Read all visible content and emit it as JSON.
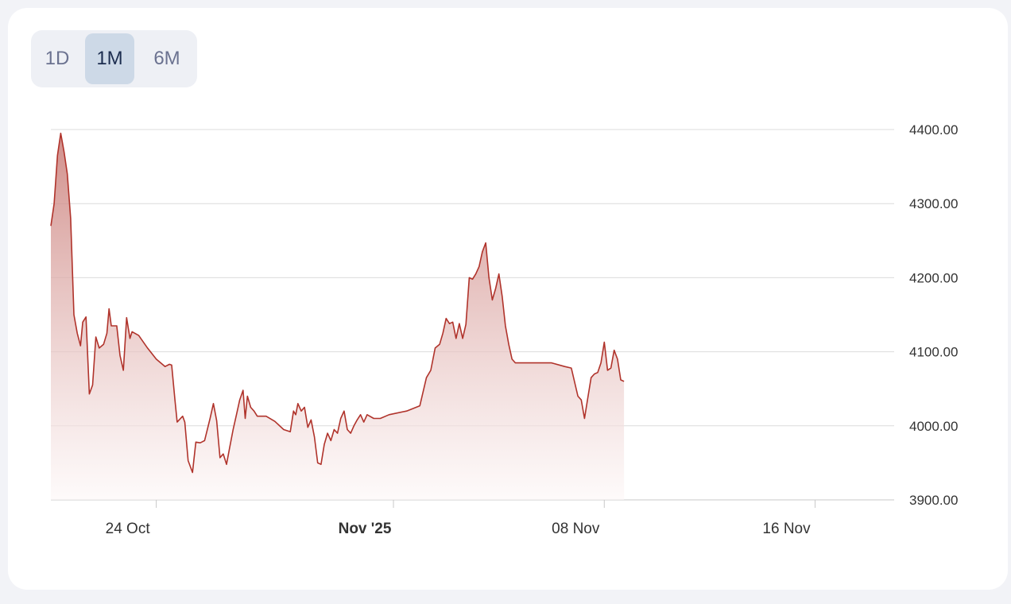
{
  "range_selector": {
    "options": [
      "1D",
      "1M",
      "6M"
    ],
    "active": "1M"
  },
  "colors": {
    "line": "#b0332b",
    "fill_top": "#c97b76",
    "fill_bottom": "#fdf7f7",
    "grid": "#dcdcdc",
    "axis_text": "#333333"
  },
  "chart_data": {
    "type": "area",
    "title": "",
    "xlabel": "",
    "ylabel": "",
    "x_start": "2025-10-19",
    "x_end": "2025-11-20",
    "ylim": [
      3900,
      4400
    ],
    "y_ticks": [
      "4400.00",
      "4300.00",
      "4200.00",
      "4100.00",
      "4000.00",
      "3900.00"
    ],
    "y_tick_values": [
      4400,
      4300,
      4200,
      4100,
      4000,
      3900
    ],
    "x_ticks": [
      {
        "label": "24 Oct",
        "date": "2025-10-23",
        "bold": false
      },
      {
        "label": "Nov '25",
        "date": "2025-11-01",
        "bold": true
      },
      {
        "label": "08 Nov",
        "date": "2025-11-09",
        "bold": false
      },
      {
        "label": "16 Nov",
        "date": "2025-11-17",
        "bold": false
      }
    ],
    "grid": true,
    "series": [
      {
        "points": [
          [
            "2025-10-19T00:00",
            4270
          ],
          [
            "2025-10-19T03:00",
            4300
          ],
          [
            "2025-10-19T06:00",
            4365
          ],
          [
            "2025-10-19T09:00",
            4395
          ],
          [
            "2025-10-19T12:00",
            4370
          ],
          [
            "2025-10-19T15:00",
            4340
          ],
          [
            "2025-10-19T18:00",
            4280
          ],
          [
            "2025-10-19T21:00",
            4150
          ],
          [
            "2025-10-20T00:00",
            4125
          ],
          [
            "2025-10-20T03:00",
            4108
          ],
          [
            "2025-10-20T05:00",
            4140
          ],
          [
            "2025-10-20T08:00",
            4147
          ],
          [
            "2025-10-20T11:00",
            4043
          ],
          [
            "2025-10-20T14:00",
            4055
          ],
          [
            "2025-10-20T17:00",
            4120
          ],
          [
            "2025-10-20T20:00",
            4105
          ],
          [
            "2025-10-21T00:00",
            4110
          ],
          [
            "2025-10-21T03:00",
            4125
          ],
          [
            "2025-10-21T05:00",
            4158
          ],
          [
            "2025-10-21T07:00",
            4135
          ],
          [
            "2025-10-21T12:00",
            4135
          ],
          [
            "2025-10-21T15:00",
            4095
          ],
          [
            "2025-10-21T18:00",
            4075
          ],
          [
            "2025-10-21T21:00",
            4146
          ],
          [
            "2025-10-22T00:00",
            4118
          ],
          [
            "2025-10-22T02:00",
            4127
          ],
          [
            "2025-10-22T08:00",
            4122
          ],
          [
            "2025-10-22T16:00",
            4105
          ],
          [
            "2025-10-23T00:00",
            4090
          ],
          [
            "2025-10-23T08:00",
            4080
          ],
          [
            "2025-10-23T12:00",
            4083
          ],
          [
            "2025-10-23T14:00",
            4082
          ],
          [
            "2025-10-23T17:00",
            4035
          ],
          [
            "2025-10-23T19:00",
            4005
          ],
          [
            "2025-10-24T00:00",
            4013
          ],
          [
            "2025-10-24T02:00",
            4005
          ],
          [
            "2025-10-24T05:00",
            3953
          ],
          [
            "2025-10-24T09:00",
            3937
          ],
          [
            "2025-10-24T12:00",
            3978
          ],
          [
            "2025-10-24T16:00",
            3977
          ],
          [
            "2025-10-24T20:00",
            3980
          ],
          [
            "2025-10-25T01:00",
            4010
          ],
          [
            "2025-10-25T04:00",
            4030
          ],
          [
            "2025-10-25T07:00",
            4007
          ],
          [
            "2025-10-25T10:00",
            3957
          ],
          [
            "2025-10-25T13:00",
            3962
          ],
          [
            "2025-10-25T16:00",
            3948
          ],
          [
            "2025-10-25T19:00",
            3972
          ],
          [
            "2025-10-25T22:00",
            3995
          ],
          [
            "2025-10-26T01:00",
            4015
          ],
          [
            "2025-10-26T04:00",
            4035
          ],
          [
            "2025-10-26T07:00",
            4048
          ],
          [
            "2025-10-26T09:00",
            4010
          ],
          [
            "2025-10-26T11:00",
            4040
          ],
          [
            "2025-10-26T14:00",
            4025
          ],
          [
            "2025-10-26T17:00",
            4020
          ],
          [
            "2025-10-26T20:00",
            4013
          ],
          [
            "2025-10-27T04:00",
            4013
          ],
          [
            "2025-10-27T12:00",
            4006
          ],
          [
            "2025-10-27T20:00",
            3995
          ],
          [
            "2025-10-28T02:00",
            3992
          ],
          [
            "2025-10-28T05:00",
            4020
          ],
          [
            "2025-10-28T07:00",
            4015
          ],
          [
            "2025-10-28T09:00",
            4030
          ],
          [
            "2025-10-28T12:00",
            4020
          ],
          [
            "2025-10-28T15:00",
            4025
          ],
          [
            "2025-10-28T18:00",
            3998
          ],
          [
            "2025-10-28T21:00",
            4008
          ],
          [
            "2025-10-29T00:00",
            3985
          ],
          [
            "2025-10-29T03:00",
            3950
          ],
          [
            "2025-10-29T06:00",
            3948
          ],
          [
            "2025-10-29T09:00",
            3975
          ],
          [
            "2025-10-29T12:00",
            3990
          ],
          [
            "2025-10-29T15:00",
            3980
          ],
          [
            "2025-10-29T18:00",
            3995
          ],
          [
            "2025-10-29T21:00",
            3990
          ],
          [
            "2025-10-30T00:00",
            4010
          ],
          [
            "2025-10-30T03:00",
            4020
          ],
          [
            "2025-10-30T06:00",
            3995
          ],
          [
            "2025-10-30T09:00",
            3990
          ],
          [
            "2025-10-30T12:00",
            4000
          ],
          [
            "2025-10-30T15:00",
            4008
          ],
          [
            "2025-10-30T18:00",
            4015
          ],
          [
            "2025-10-30T21:00",
            4005
          ],
          [
            "2025-10-31T00:00",
            4015
          ],
          [
            "2025-10-31T06:00",
            4010
          ],
          [
            "2025-10-31T12:00",
            4010
          ],
          [
            "2025-10-31T20:00",
            4015
          ],
          [
            "2025-11-01T12:00",
            4020
          ],
          [
            "2025-11-02T00:00",
            4027
          ],
          [
            "2025-11-02T06:00",
            4065
          ],
          [
            "2025-11-02T10:00",
            4075
          ],
          [
            "2025-11-02T14:00",
            4105
          ],
          [
            "2025-11-02T18:00",
            4110
          ],
          [
            "2025-11-02T21:00",
            4125
          ],
          [
            "2025-11-03T00:00",
            4145
          ],
          [
            "2025-11-03T03:00",
            4138
          ],
          [
            "2025-11-03T06:00",
            4140
          ],
          [
            "2025-11-03T09:00",
            4118
          ],
          [
            "2025-11-03T12:00",
            4138
          ],
          [
            "2025-11-03T15:00",
            4118
          ],
          [
            "2025-11-03T18:00",
            4137
          ],
          [
            "2025-11-03T21:00",
            4200
          ],
          [
            "2025-11-04T00:00",
            4198
          ],
          [
            "2025-11-04T03:00",
            4205
          ],
          [
            "2025-11-04T06:00",
            4215
          ],
          [
            "2025-11-04T09:00",
            4235
          ],
          [
            "2025-11-04T12:00",
            4247
          ],
          [
            "2025-11-04T15:00",
            4200
          ],
          [
            "2025-11-04T18:00",
            4170
          ],
          [
            "2025-11-04T21:00",
            4185
          ],
          [
            "2025-11-05T00:00",
            4205
          ],
          [
            "2025-11-05T03:00",
            4175
          ],
          [
            "2025-11-05T06:00",
            4135
          ],
          [
            "2025-11-05T09:00",
            4110
          ],
          [
            "2025-11-05T12:00",
            4090
          ],
          [
            "2025-11-05T15:00",
            4085
          ],
          [
            "2025-11-06T00:00",
            4085
          ],
          [
            "2025-11-06T12:00",
            4085
          ],
          [
            "2025-11-07T00:00",
            4085
          ],
          [
            "2025-11-07T12:00",
            4080
          ],
          [
            "2025-11-07T18:00",
            4078
          ],
          [
            "2025-11-08T00:00",
            4040
          ],
          [
            "2025-11-08T03:00",
            4035
          ],
          [
            "2025-11-08T06:00",
            4010
          ],
          [
            "2025-11-08T09:00",
            4038
          ],
          [
            "2025-11-08T12:00",
            4065
          ],
          [
            "2025-11-08T15:00",
            4070
          ],
          [
            "2025-11-08T18:00",
            4072
          ],
          [
            "2025-11-08T21:00",
            4085
          ],
          [
            "2025-11-09T00:00",
            4113
          ],
          [
            "2025-11-09T03:00",
            4075
          ],
          [
            "2025-11-09T06:00",
            4078
          ],
          [
            "2025-11-09T09:00",
            4102
          ],
          [
            "2025-11-09T12:00",
            4090
          ],
          [
            "2025-11-09T15:00",
            4062
          ],
          [
            "2025-11-09T18:00",
            4060
          ]
        ]
      }
    ]
  }
}
